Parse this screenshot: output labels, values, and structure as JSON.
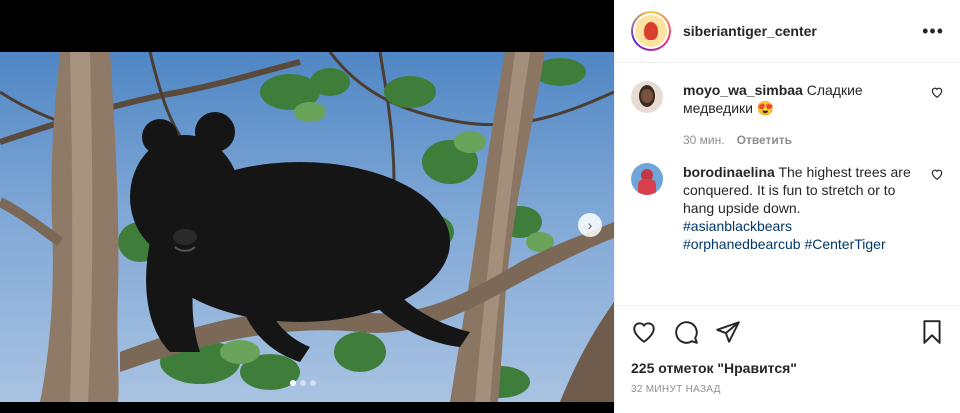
{
  "post": {
    "account": "siberiantiger_center",
    "more_label": "•••",
    "likes_text": "225 отметок \"Нравится\"",
    "timestamp": "32 МИНУТ НАЗАД"
  },
  "comments": [
    {
      "user": "moyo_wa_simbaa",
      "text": "Сладкие медведики 😍",
      "time": "30 мин.",
      "reply_label": "Ответить"
    },
    {
      "user": "borodinaelina",
      "text": "The highest trees are conquered. It is fun to stretch or to hang upside down.",
      "hashtags": [
        "#asianblackbears",
        "#orphanedbearcub",
        "#CenterTiger"
      ]
    }
  ],
  "carousel": {
    "next_icon": "chevron-right-icon",
    "slide_count": 3,
    "active_slide": 1
  },
  "colors": {
    "link": "#00376b",
    "muted": "#8e8e8e",
    "text": "#262626"
  }
}
